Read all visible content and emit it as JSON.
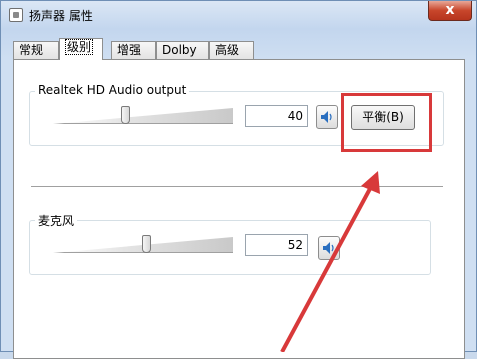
{
  "window": {
    "title": "扬声器 属性",
    "close_label": "x"
  },
  "tabs": [
    {
      "label": "常规",
      "active": false
    },
    {
      "label": "级别",
      "active": true
    },
    {
      "label": "增强",
      "active": false
    },
    {
      "label": "Dolby",
      "active": false
    },
    {
      "label": "高级",
      "active": false
    }
  ],
  "output_group": {
    "label": "Realtek HD Audio output",
    "volume": "40",
    "volume_level": 40,
    "balance_label": "平衡(B)"
  },
  "mic_group": {
    "label": "麦克风",
    "volume": "52",
    "volume_level": 52
  },
  "annotation": {
    "highlight_color": "#d8393a"
  }
}
